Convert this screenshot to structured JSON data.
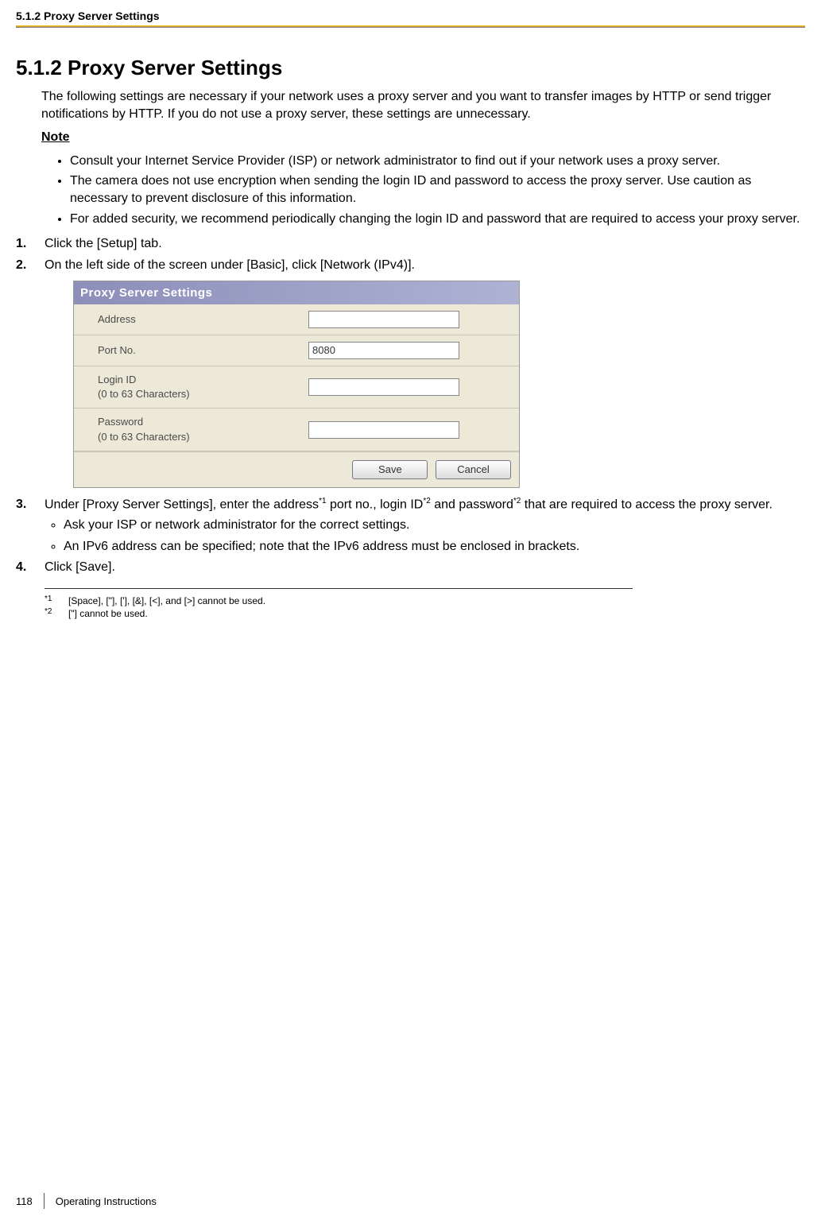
{
  "running_head": "5.1.2 Proxy Server Settings",
  "section": {
    "number": "5.1.2",
    "title": "Proxy Server Settings",
    "heading_combined": "5.1.2  Proxy Server Settings"
  },
  "intro": "The following settings are necessary if your network uses a proxy server and you want to transfer images by HTTP or send trigger notifications by HTTP. If you do not use a proxy server, these settings are unnecessary.",
  "note": {
    "label": "Note",
    "items": [
      "Consult your Internet Service Provider (ISP) or network administrator to find out if your network uses a proxy server.",
      "The camera does not use encryption when sending the login ID and password to access the proxy server. Use caution as necessary to prevent disclosure of this information.",
      "For added security, we recommend periodically changing the login ID and password that are required to access your proxy server."
    ]
  },
  "steps": {
    "s1": "Click the [Setup] tab.",
    "s2": "On the left side of the screen under [Basic], click [Network (IPv4)].",
    "s3_pre": "Under [Proxy Server Settings], enter the address",
    "s3_mid1": " port no., login ID",
    "s3_mid2": " and password",
    "s3_post": " that are required to access the proxy server.",
    "s3_sub": [
      "Ask your ISP or network administrator for the correct settings.",
      "An IPv6 address can be specified; note that the IPv6 address must be enclosed in brackets."
    ],
    "s4": "Click [Save]."
  },
  "screenshot": {
    "header": "Proxy Server Settings",
    "rows": {
      "address": {
        "label": "Address",
        "value": ""
      },
      "port": {
        "label": "Port No.",
        "value": "8080"
      },
      "login": {
        "label_line1": "Login ID",
        "label_line2": "(0 to 63 Characters)",
        "value": ""
      },
      "password": {
        "label_line1": "Password",
        "label_line2": "(0 to 63 Characters)",
        "value": ""
      }
    },
    "buttons": {
      "save": "Save",
      "cancel": "Cancel"
    }
  },
  "footnotes": {
    "f1": {
      "mark": "*1",
      "text": "[Space], [\"], ['], [&], [<], and [>] cannot be used."
    },
    "f2": {
      "mark": "*2",
      "text": "[\"] cannot be used."
    }
  },
  "footer": {
    "page": "118",
    "doc": "Operating Instructions"
  }
}
